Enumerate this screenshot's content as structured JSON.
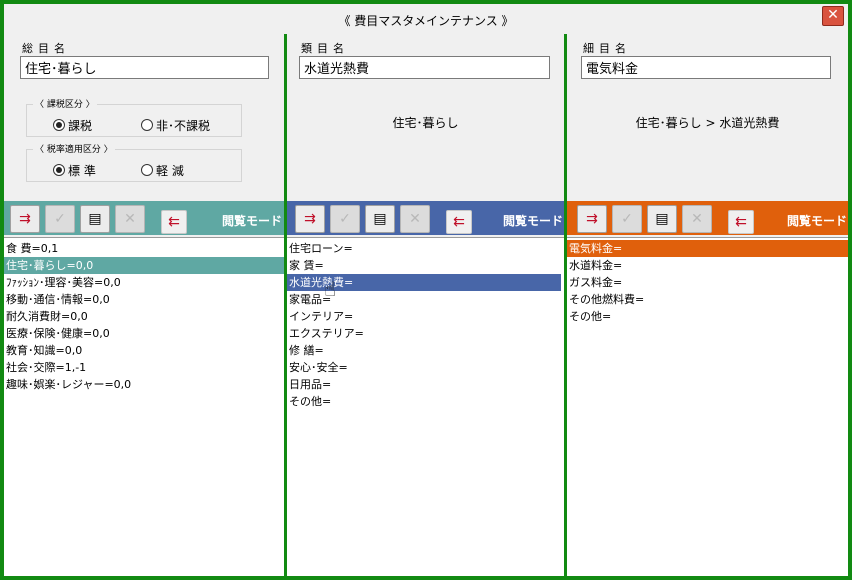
{
  "window": {
    "title": "《 費目マスタメインテナンス 》",
    "close_glyph": "✕"
  },
  "col1": {
    "label": "総目名",
    "value": "住宅･暮らし",
    "tax_group": {
      "title": "〈 課税区分 〉",
      "options": [
        "課税",
        "非･不課税"
      ],
      "selected": 0
    },
    "rate_group": {
      "title": "〈 税率適用区分 〉",
      "options": [
        "標 準",
        "軽 減"
      ],
      "selected": 0
    },
    "mode": "閲覧モード",
    "items": [
      "食 費=0,1",
      "住宅･暮らし=0,0",
      "ﾌｧｯｼｮﾝ･理容･美容=0,0",
      "移動･通信･情報=0,0",
      "耐久消費財=0,0",
      "医療･保険･健康=0,0",
      "教育･知識=0,0",
      "社会･交際=1,-1",
      "趣味･娯楽･レジャー=0,0"
    ],
    "selected_index": 1
  },
  "col2": {
    "label": "類目名",
    "value": "水道光熱費",
    "breadcrumb": "住宅･暮らし",
    "mode": "閲覧モード",
    "items": [
      "住宅ローン=",
      "家 賃=",
      "水道光熱費=",
      "家電品=",
      "インテリア=",
      "エクステリア=",
      "修 繕=",
      "安心･安全=",
      "日用品=",
      "その他="
    ],
    "selected_index": 2
  },
  "col3": {
    "label": "細目名",
    "value": "電気料金",
    "breadcrumb": "住宅･暮らし > 水道光熱費",
    "mode": "閲覧モード",
    "items": [
      "電気料金=",
      "水道料金=",
      "ガス料金=",
      "その他燃料費=",
      "その他="
    ],
    "selected_index": 0
  },
  "colors": {
    "border": "#128a12",
    "toolbar1": "#5fa8a3",
    "toolbar2": "#4866a8",
    "toolbar3": "#e0600c",
    "select1": "#5fa8a3",
    "select2": "#4866a8",
    "select3": "#e0600c"
  },
  "toolbar_icons": [
    "add-icon",
    "check-icon",
    "edit-icon",
    "delete-icon",
    "move-icon"
  ]
}
